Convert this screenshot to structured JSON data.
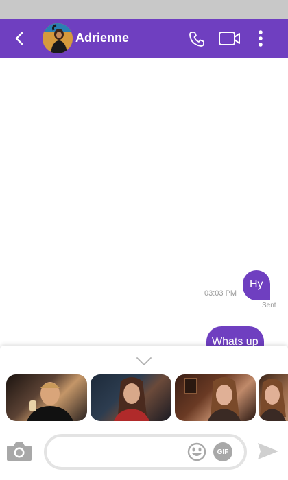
{
  "header": {
    "contact_name": "Adrienne",
    "icons": [
      "back-arrow-icon",
      "phone-icon",
      "video-camera-icon",
      "more-vertical-icon"
    ]
  },
  "messages": [
    {
      "text": "Hy",
      "time": "03:03 PM",
      "status": "Sent",
      "direction": "outgoing"
    },
    {
      "text": "Whats up",
      "direction": "outgoing"
    }
  ],
  "gif_panel": {
    "items": [
      "gif-1",
      "gif-2",
      "gif-3",
      "gif-4"
    ]
  },
  "composer": {
    "placeholder": "",
    "gif_label": "GIF",
    "icons": [
      "camera-icon",
      "emoji-icon",
      "send-icon"
    ]
  },
  "colors": {
    "accent": "#6f3fc0",
    "status_bar": "#c8c8c8",
    "muted_text": "#9a9a9a"
  }
}
